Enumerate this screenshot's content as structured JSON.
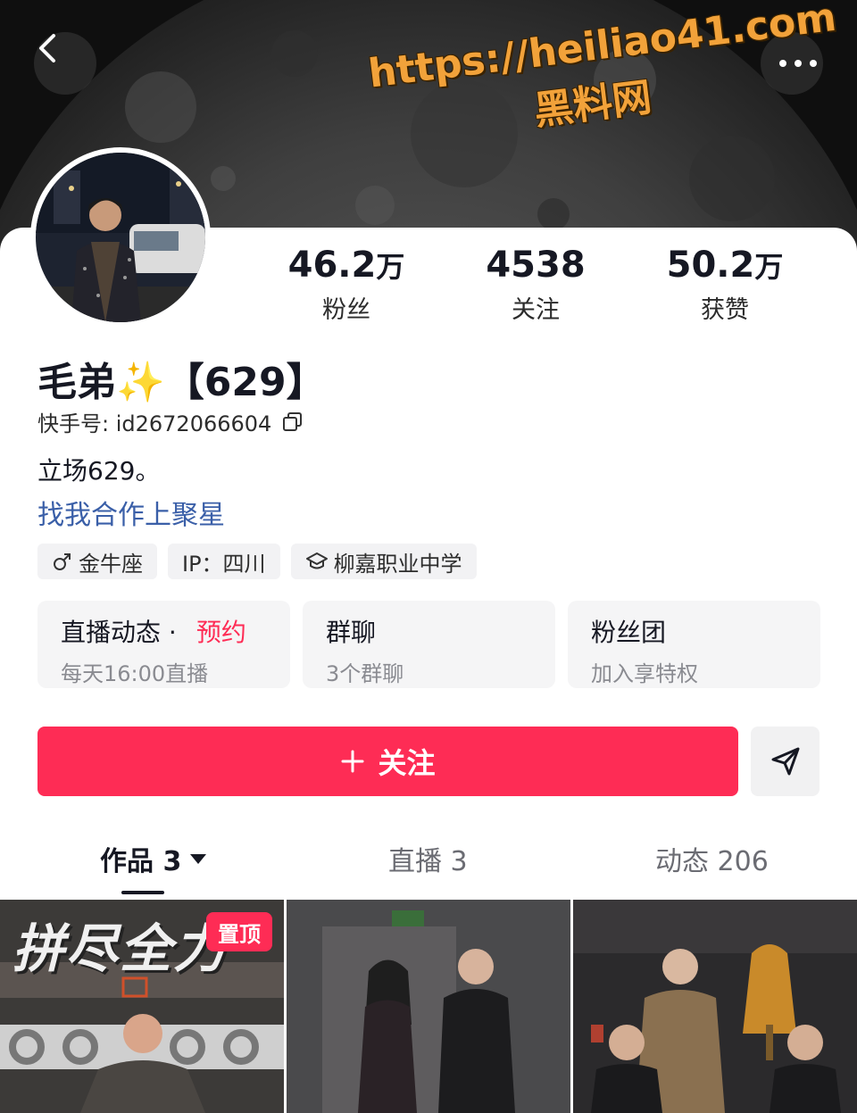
{
  "watermark": {
    "url": "https://heiliao41.com",
    "name": "黑料网"
  },
  "stats": {
    "fans": {
      "value": "46.2",
      "unit": "万",
      "label": "粉丝"
    },
    "following": {
      "value": "4538",
      "unit": "",
      "label": "关注"
    },
    "likes": {
      "value": "50.2",
      "unit": "万",
      "label": "获赞"
    }
  },
  "profile": {
    "name": "毛弟✨【629】",
    "id_label": "快手号: id2672066604",
    "bio_line1": "立场629。",
    "bio_line2": "找我合作上聚星"
  },
  "tags": [
    {
      "icon": "male-icon",
      "text": "金牛座"
    },
    {
      "icon": "",
      "text": "IP：四川"
    },
    {
      "icon": "graduation-cap-icon",
      "text": "柳嘉职业中学"
    }
  ],
  "features": [
    {
      "title": "直播动态 ·",
      "highlight": "预约",
      "sub": "每天16:00直播"
    },
    {
      "title": "群聊",
      "highlight": "",
      "sub": "3个群聊"
    },
    {
      "title": "粉丝团",
      "highlight": "",
      "sub": "加入享特权"
    }
  ],
  "actions": {
    "follow_label": "关注",
    "follow_icon": "plus-icon",
    "share_icon": "send-icon"
  },
  "tabs": {
    "works": "作品 3",
    "live": "直播 3",
    "moments": "动态 206"
  },
  "grid": {
    "pin_label": "置顶",
    "thumb1_overlay": "拼尽全力"
  },
  "colors": {
    "accent": "#fe2c55",
    "link": "#3a5fa8",
    "watermark": "#f2a23a"
  }
}
